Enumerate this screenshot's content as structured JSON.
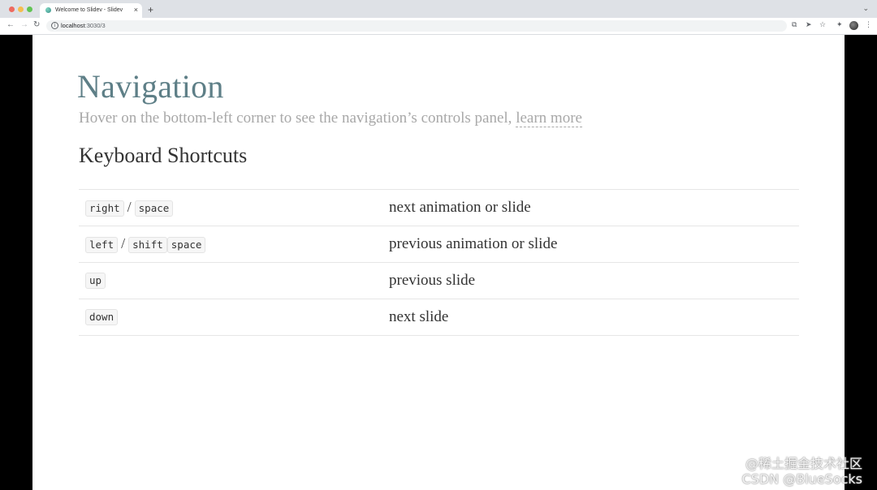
{
  "browser": {
    "tab_title": "Welcome to Slidev - Slidev",
    "tab_close": "×",
    "new_tab": "+",
    "url_host": "localhost",
    "url_path": ":3030/3"
  },
  "slide": {
    "title": "Navigation",
    "subtitle_text": "Hover on the bottom-left corner to see the navigation’s controls panel,",
    "learn_more": "learn more",
    "section_heading": "Keyboard Shortcuts",
    "shortcuts": [
      {
        "keys": [
          "right",
          "space"
        ],
        "seps": [
          "/"
        ],
        "description": "next animation or slide"
      },
      {
        "keys": [
          "left",
          "shift",
          "space"
        ],
        "seps": [
          "/"
        ],
        "description": "previous animation or slide"
      },
      {
        "keys": [
          "up"
        ],
        "seps": [],
        "description": "previous slide"
      },
      {
        "keys": [
          "down"
        ],
        "seps": [],
        "description": "next slide"
      }
    ]
  },
  "watermark": {
    "line1": "@稀土掘金技术社区",
    "line2": "CSDN @BlueSocks"
  }
}
